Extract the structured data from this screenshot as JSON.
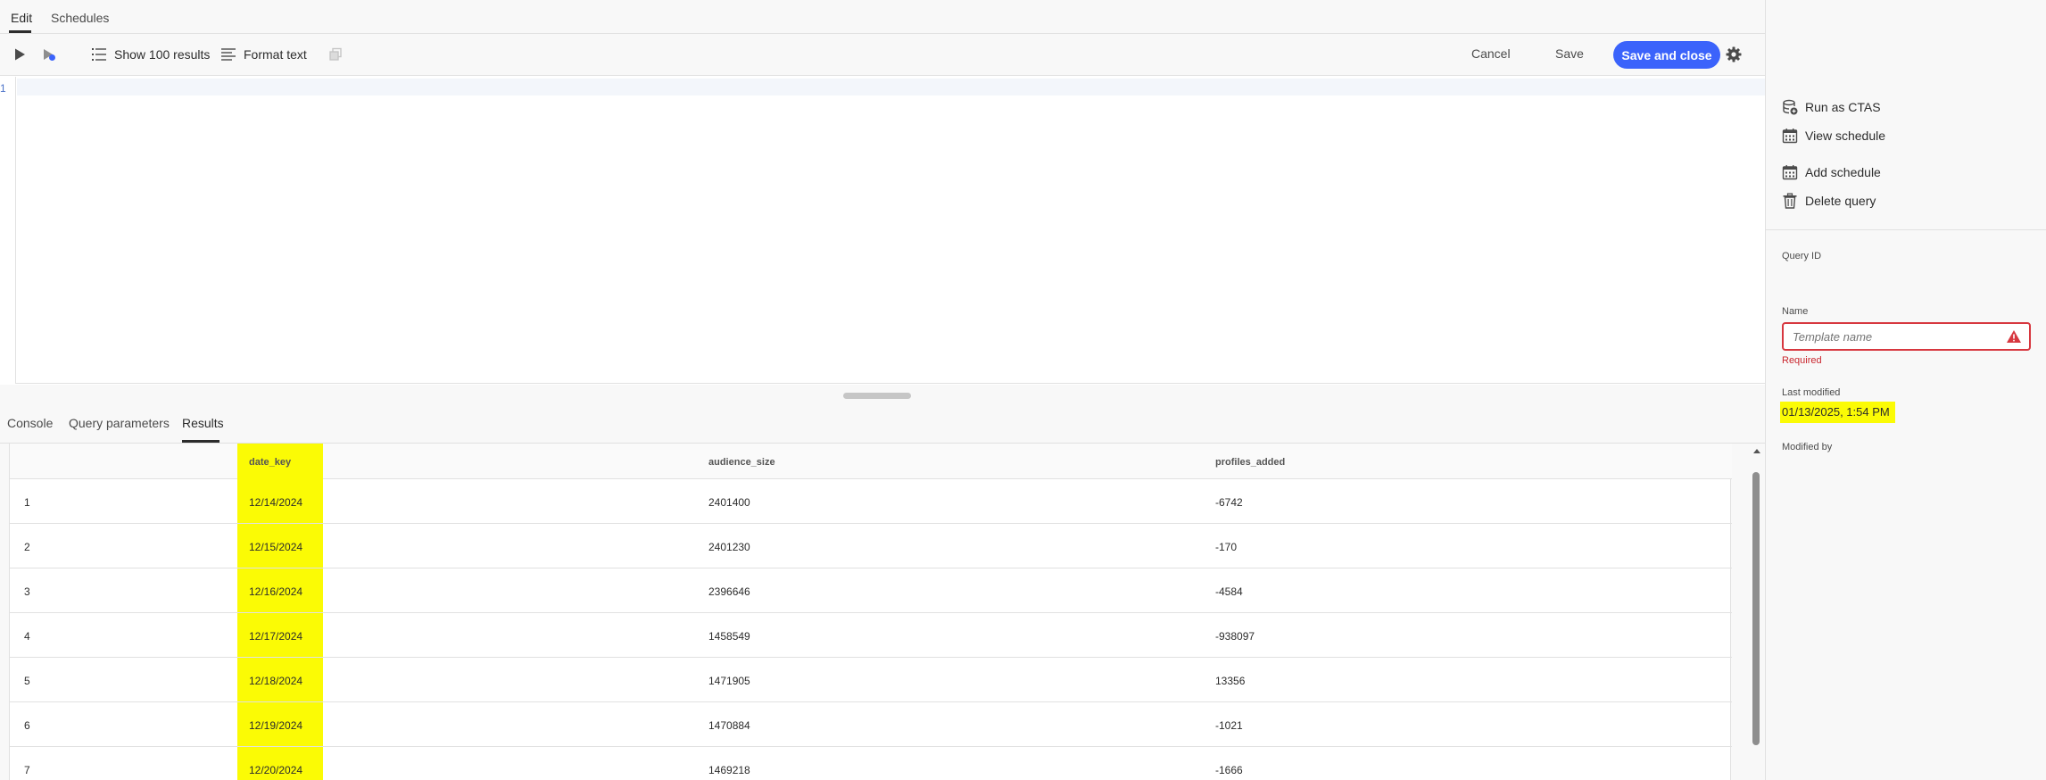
{
  "top_tabs": {
    "edit": "Edit",
    "schedules": "Schedules"
  },
  "toolbar": {
    "run_icon": "play-icon",
    "run_selected_icon": "run-selected-icon",
    "show_results_label": "Show 100 results",
    "format_text_label": "Format text",
    "copy_icon": "copy-icon",
    "cancel_label": "Cancel",
    "save_label": "Save",
    "save_close_label": "Save and close",
    "settings_icon": "gear-icon"
  },
  "editor": {
    "line_number": "1"
  },
  "bottom_tabs": {
    "console": "Console",
    "query_parameters": "Query parameters",
    "results": "Results"
  },
  "results": {
    "columns": [
      "date_key",
      "audience_size",
      "profiles_added"
    ],
    "rows": [
      {
        "index": "1",
        "date_key": "12/14/2024",
        "audience_size": "2401400",
        "profiles_added": "-6742"
      },
      {
        "index": "2",
        "date_key": "12/15/2024",
        "audience_size": "2401230",
        "profiles_added": "-170"
      },
      {
        "index": "3",
        "date_key": "12/16/2024",
        "audience_size": "2396646",
        "profiles_added": "-4584"
      },
      {
        "index": "4",
        "date_key": "12/17/2024",
        "audience_size": "1458549",
        "profiles_added": "-938097"
      },
      {
        "index": "5",
        "date_key": "12/18/2024",
        "audience_size": "1471905",
        "profiles_added": "13356"
      },
      {
        "index": "6",
        "date_key": "12/19/2024",
        "audience_size": "1470884",
        "profiles_added": "-1021"
      },
      {
        "index": "7",
        "date_key": "12/20/2024",
        "audience_size": "1469218",
        "profiles_added": "-1666"
      }
    ],
    "highlight_color": "#fbfb05"
  },
  "right_panel": {
    "actions": [
      {
        "label": "Run as CTAS",
        "icon": "database-add-icon"
      },
      {
        "label": "View schedule",
        "icon": "calendar-icon"
      },
      {
        "label": "Add schedule",
        "icon": "calendar-add-icon"
      },
      {
        "label": "Delete query",
        "icon": "trash-icon"
      }
    ],
    "query_id_label": "Query ID",
    "name_label": "Name",
    "name_placeholder": "Template name",
    "required_text": "Required",
    "last_modified_label": "Last modified",
    "last_modified_value": "01/13/2025, 1:54 PM",
    "modified_by_label": "Modified by"
  },
  "colors": {
    "accent": "#3b63fb",
    "error": "#d7373f",
    "highlight": "#fbfb05"
  }
}
